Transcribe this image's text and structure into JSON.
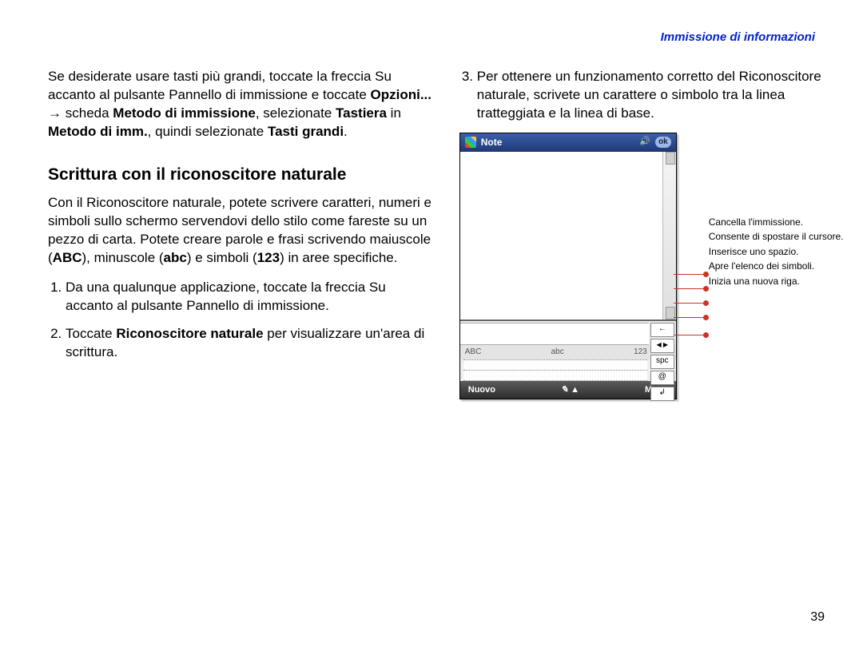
{
  "header": "Immissione di informazioni",
  "page_number": "39",
  "left": {
    "para1_plain1": "Se desiderate usare tasti più grandi, toccate la freccia Su accanto al pulsante Pannello di immissione e toccate ",
    "para1_bold1": "Opzioni...",
    "para1_arrow": " → ",
    "para1_plain2": " scheda ",
    "para1_bold2": "Metodo di immissione",
    "para1_plain3": ", selezionate ",
    "para1_bold3": "Tastiera",
    "para1_plain4": " in ",
    "para1_bold4": "Metodo di imm.",
    "para1_plain5": ", quindi selezionate ",
    "para1_bold5": "Tasti grandi",
    "para1_plain6": ".",
    "heading": "Scrittura con il riconoscitore naturale",
    "para2_a": "Con il Riconoscitore naturale, potete scrivere caratteri, numeri e simboli sullo schermo servendovi dello stilo come fareste su un pezzo di carta. Potete creare parole e frasi scrivendo maiuscole (",
    "para2_b1": "ABC",
    "para2_b": "), minuscole (",
    "para2_b2": "abc",
    "para2_c": ") e simboli (",
    "para2_b3": "123",
    "para2_d": ") in aree specifiche.",
    "li1": "Da una qualunque applicazione, toccate la freccia Su accanto al pulsante Pannello di immissione.",
    "li2_a": "Toccate ",
    "li2_b": "Riconoscitore naturale",
    "li2_c": " per visualizzare un'area di scrittura."
  },
  "right": {
    "li3": "Per ottenere un funzionamento corretto del Riconoscitore naturale, scrivete un carattere o simbolo tra la linea tratteggiata e la linea di base.",
    "device": {
      "title": "Note",
      "ok": "ok",
      "labels": {
        "abc_u": "ABC",
        "abc_l": "abc",
        "num": "123"
      },
      "spc": "spc",
      "bottom_left": "Nuovo",
      "bottom_right": "Menu"
    },
    "callouts": {
      "c1": "Cancella l'immissione.",
      "c2": "Consente di spostare il cursore.",
      "c3": "Inserisce uno spazio.",
      "c4": "Apre l'elenco dei simboli.",
      "c5": "Inizia una nuova riga."
    }
  }
}
